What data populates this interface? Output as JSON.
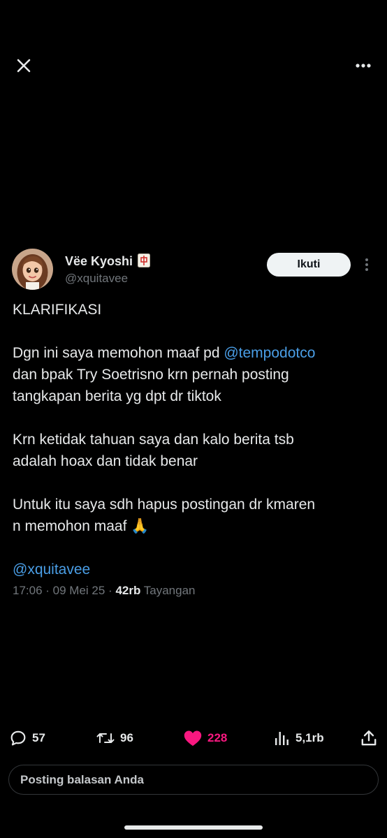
{
  "topbar": {
    "close_icon": "close-icon",
    "more_icon": "more-horizontal-icon"
  },
  "tweet": {
    "author": {
      "display_name": "Vëe Kyoshi",
      "name_emoji": "mahjong-tile-icon",
      "handle": "@xquitavee"
    },
    "follow_label": "Ikuti",
    "body": {
      "line1": "KLARIFIKASI",
      "p2_prefix": "Dgn ini saya memohon maaf pd ",
      "p2_mention": "@tempodotco",
      "p2_suffix": "\ndan bpak Try Soetrisno krn pernah posting\ntangkapan berita yg dpt dr tiktok",
      "p3": "Krn ketidak tahuan saya dan kalo berita tsb\nadalah hoax dan tidak benar",
      "p4": "Untuk itu saya sdh hapus postingan dr kmaren\nn memohon maaf 🙏",
      "mention_tail": "@xquitavee"
    },
    "meta": {
      "time": "17:06",
      "sep1": " · ",
      "date": "09 Mei 25",
      "sep2": " · ",
      "views": "42rb",
      "views_label": " Tayangan"
    }
  },
  "actions": {
    "replies": "57",
    "reposts": "96",
    "likes": "228",
    "views": "5,1rb"
  },
  "colors": {
    "accent": "#4a9ee6",
    "like": "#f91880",
    "muted": "#71767b"
  },
  "reply": {
    "placeholder": "Posting balasan Anda"
  }
}
